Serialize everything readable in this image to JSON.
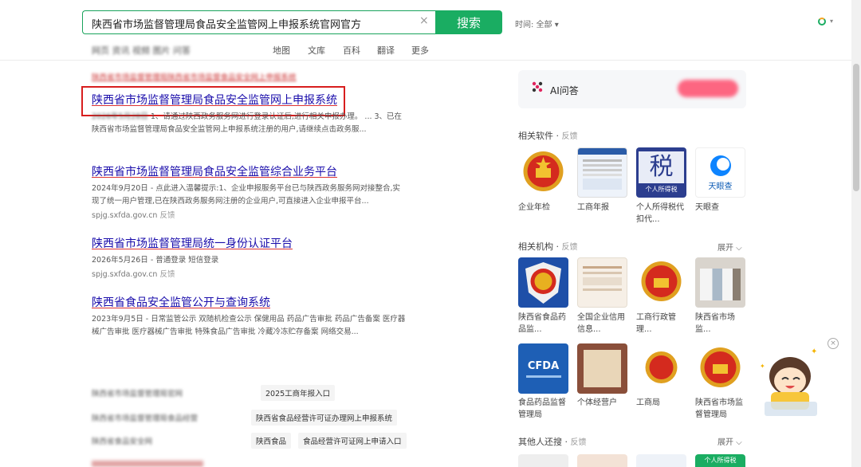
{
  "search": {
    "query": "陕西省市场监督管理局食品安全监管网上申报系统官网官方",
    "clear": "×",
    "button": "搜索",
    "time_filter": "时间: 全部 ▾"
  },
  "tabs": [
    "地图",
    "文库",
    "百科",
    "翻译",
    "更多"
  ],
  "tabs_blurred": "网页 资讯 视频 图片 问答",
  "results": [
    {
      "pre_line": "陕西省市场监督管理局陕西省市场监督食品安全网上申报系统",
      "title": "陕西省市场监督管理局食品安全监管网上申报系统",
      "date": "2026年5月28日",
      "line1": "1、请通过陕西政务服务网进行登录认证后,进行相关申报办理。 ... 3、已在",
      "line2": "陕西省市场监督管理局食品安全监管网上申报系统注册的用户,请继续点击政务服..."
    },
    {
      "title": "陕西省市场监督管理局食品安全监管综合业务平台",
      "line1": "2024年9月20日 - 点此进入温馨提示:1、企业申报服务平台已与陕西政务服务网对接整合,实",
      "line2": "现了统一用户管理,已在陕西政务服务网注册的企业用户,可直接进入企业申报平台...",
      "url": "spjg.sxfda.gov.cn",
      "feedback": "反馈"
    },
    {
      "title": "陕西省市场监督管理局统一身份认证平台",
      "line1": "2026年5月26日 - 普通登录 短信登录",
      "url": "spjg.sxfda.gov.cn",
      "feedback": "反馈"
    },
    {
      "title": "陕西省食品安全监管公开与查询系统",
      "line1": "2023年9月5日 - 日常监管公示 双随机检查公示 保健用品 药品广告审批 药品广告备案 医疗器",
      "line2": "械广告审批 医疗器械广告审批 特殊食品广告审批 冷藏冷冻贮存备案 网络交易..."
    }
  ],
  "related_searches": [
    {
      "blur": "陕西省市场监督管理局官网",
      "tag": "2025工商年报入口"
    },
    {
      "blur": "陕西省市场监督管理局食品经营",
      "tag": "陕西省食品经营许可证办理网上申报系统"
    },
    {
      "blur": "陕西省食品安全网",
      "tag": "陕西食品",
      "tag2": "食品经营许可证网上申请入口"
    }
  ],
  "right": {
    "ai_label": "AI问答",
    "software_title": "相关软件",
    "feedback": "反馈",
    "software": [
      {
        "name": "企业年检",
        "icon": "national-emblem"
      },
      {
        "name": "工商年报",
        "icon": "webpage-screenshot"
      },
      {
        "name": "个人所得税代扣代...",
        "icon": "tax-logo",
        "badge": "税",
        "sub": "个人所得税"
      },
      {
        "name": "天眼查",
        "icon": "tianyancha-logo",
        "badge": "天眼查"
      }
    ],
    "org_title": "相关机构",
    "expand": "展开",
    "orgs": [
      {
        "name": "陕西省食品药品监...",
        "icon": "national-emblem-shield"
      },
      {
        "name": "全国企业信用信息...",
        "icon": "webpage-screenshot"
      },
      {
        "name": "工商行政管理...",
        "icon": "national-emblem"
      },
      {
        "name": "陕西省市场监...",
        "icon": "office-photo"
      },
      {
        "name": "食品药品监督管理局",
        "icon": "cfda-logo",
        "badge": "CFDA"
      },
      {
        "name": "个体经营户",
        "icon": "license-photo"
      },
      {
        "name": "工商局",
        "icon": "national-emblem"
      },
      {
        "name": "陕西省市场监督管理局",
        "icon": "national-emblem"
      }
    ],
    "others_title": "其他人还搜",
    "others_thumb_text": "个人所得税"
  },
  "colors": {
    "brand_green": "#1aad62",
    "link_blue": "#1a0dab",
    "highlight_red": "#c00",
    "redbox": "#d81e1e"
  }
}
